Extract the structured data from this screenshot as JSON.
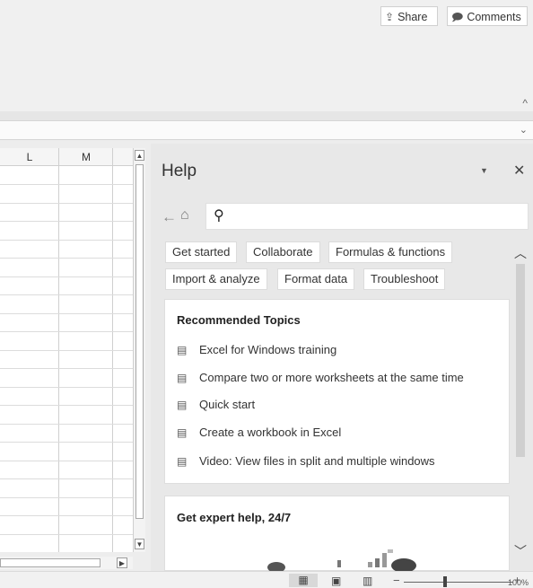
{
  "ribbon": {
    "share_label": "Share",
    "comments_label": "Comments",
    "collapse_icon": "chevron-up",
    "expand_formula_icon": "chevron-down"
  },
  "sheet": {
    "columns": [
      "L",
      "M"
    ]
  },
  "help": {
    "title": "Help",
    "search_placeholder": "",
    "chips": [
      "Get started",
      "Collaborate",
      "Formulas & functions",
      "Import & analyze",
      "Format data",
      "Troubleshoot"
    ],
    "recommended": {
      "title": "Recommended Topics",
      "topics": [
        "Excel for Windows training",
        "Compare two or more worksheets at the same time",
        "Quick start",
        "Create a workbook in Excel",
        "Video: View files in split and multiple windows"
      ]
    },
    "expert": {
      "title": "Get expert help, 24/7"
    }
  },
  "status": {
    "zoom_minus": "−",
    "zoom_plus": "+",
    "zoom_value": "100%",
    "zoom_level_percent": 100
  }
}
